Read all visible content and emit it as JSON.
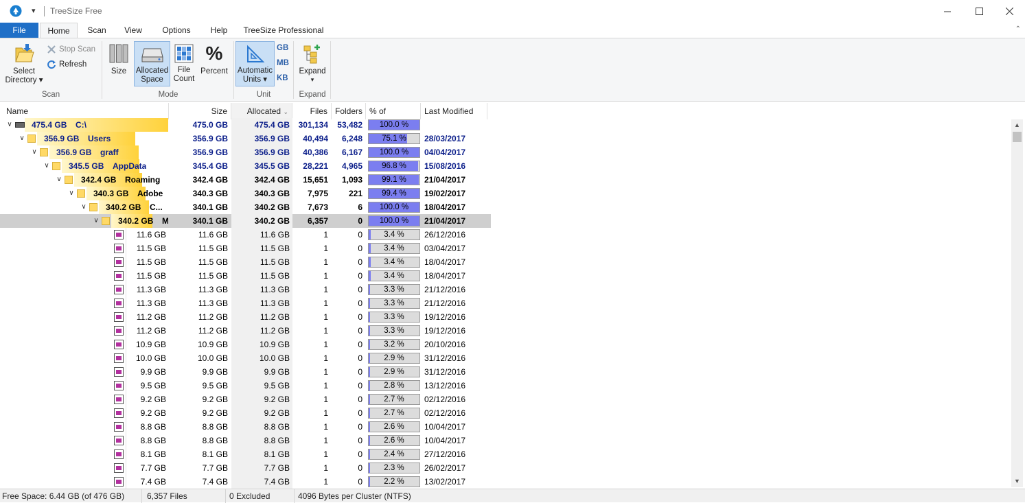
{
  "window": {
    "title": "TreeSize Free",
    "controls": [
      "minimize",
      "maximize",
      "close"
    ]
  },
  "tabs": [
    {
      "label": "File",
      "key": "file"
    },
    {
      "label": "Home",
      "key": "home",
      "active": true
    },
    {
      "label": "Scan",
      "key": "scan"
    },
    {
      "label": "View",
      "key": "view"
    },
    {
      "label": "Options",
      "key": "options"
    },
    {
      "label": "Help",
      "key": "help"
    },
    {
      "label": "TreeSize Professional",
      "key": "pro"
    }
  ],
  "ribbon": {
    "scan": {
      "select_directory": "Select\nDirectory",
      "stop_scan": "Stop Scan",
      "refresh": "Refresh",
      "group_label": "Scan"
    },
    "mode": {
      "size": "Size",
      "allocated_space": "Allocated\nSpace",
      "file_count": "File\nCount",
      "percent": "Percent",
      "percent_glyph": "%",
      "group_label": "Mode"
    },
    "unit": {
      "automatic_units": "Automatic\nUnits",
      "gb": "GB",
      "mb": "MB",
      "kb": "KB",
      "group_label": "Unit"
    },
    "expand": {
      "expand": "Expand",
      "group_label": "Expand"
    }
  },
  "columns": {
    "name": "Name",
    "size": "Size",
    "allocated": "Allocated",
    "files": "Files",
    "folders": "Folders",
    "percent": "% of Paren...",
    "modified": "Last Modified"
  },
  "tree_rows": [
    {
      "depth": 0,
      "kind": "drive",
      "name_size": "475.4 GB",
      "name": "C:\\",
      "size": "475.0 GB",
      "allocated": "475.4 GB",
      "files": "301,134",
      "folders": "53,482",
      "percent": 100.0,
      "percent_label": "100.0 %",
      "modified": "",
      "style": "blue",
      "barfrac": 1.0
    },
    {
      "depth": 1,
      "kind": "folder",
      "name_size": "356.9 GB",
      "name": "Users",
      "size": "356.9 GB",
      "allocated": "356.9 GB",
      "files": "40,494",
      "folders": "6,248",
      "percent": 75.1,
      "percent_label": "75.1 %",
      "modified": "28/03/2017",
      "style": "blue",
      "barfrac": 0.75
    },
    {
      "depth": 2,
      "kind": "folder",
      "name_size": "356.9 GB",
      "name": "graff",
      "size": "356.9 GB",
      "allocated": "356.9 GB",
      "files": "40,386",
      "folders": "6,167",
      "percent": 100.0,
      "percent_label": "100.0 %",
      "modified": "04/04/2017",
      "style": "blue",
      "barfrac": 0.75
    },
    {
      "depth": 3,
      "kind": "folder",
      "name_size": "345.5 GB",
      "name": "AppData",
      "size": "345.4 GB",
      "allocated": "345.5 GB",
      "files": "28,221",
      "folders": "4,965",
      "percent": 96.8,
      "percent_label": "96.8 %",
      "modified": "15/08/2016",
      "style": "blue",
      "barfrac": 0.73
    },
    {
      "depth": 4,
      "kind": "folder",
      "name_size": "342.4 GB",
      "name": "Roaming",
      "size": "342.4 GB",
      "allocated": "342.4 GB",
      "files": "15,651",
      "folders": "1,093",
      "percent": 99.1,
      "percent_label": "99.1 %",
      "modified": "21/04/2017",
      "style": "black",
      "barfrac": 0.72
    },
    {
      "depth": 5,
      "kind": "folder",
      "name_size": "340.3 GB",
      "name": "Adobe",
      "size": "340.3 GB",
      "allocated": "340.3 GB",
      "files": "7,975",
      "folders": "221",
      "percent": 99.4,
      "percent_label": "99.4 %",
      "modified": "19/02/2017",
      "style": "black",
      "barfrac": 0.72
    },
    {
      "depth": 6,
      "kind": "folder",
      "name_size": "340.2 GB",
      "name": "C...",
      "size": "340.1 GB",
      "allocated": "340.2 GB",
      "files": "7,673",
      "folders": "6",
      "percent": 100.0,
      "percent_label": "100.0 %",
      "modified": "18/04/2017",
      "style": "black",
      "barfrac": 0.72
    },
    {
      "depth": 7,
      "kind": "folder",
      "name_size": "340.2 GB",
      "name": "M...",
      "size": "340.1 GB",
      "allocated": "340.2 GB",
      "files": "6,357",
      "folders": "0",
      "percent": 100.0,
      "percent_label": "100.0 %",
      "modified": "21/04/2017",
      "style": "black",
      "barfrac": 0.72,
      "selected": true
    }
  ],
  "file_rows": [
    {
      "name_size": "11.6 GB",
      "size": "11.6 GB",
      "allocated": "11.6 GB",
      "files": "1",
      "folders": "0",
      "percent": 3.4,
      "percent_label": "3.4 %",
      "modified": "26/12/2016"
    },
    {
      "name_size": "11.5 GB",
      "size": "11.5 GB",
      "allocated": "11.5 GB",
      "files": "1",
      "folders": "0",
      "percent": 3.4,
      "percent_label": "3.4 %",
      "modified": "03/04/2017"
    },
    {
      "name_size": "11.5 GB",
      "size": "11.5 GB",
      "allocated": "11.5 GB",
      "files": "1",
      "folders": "0",
      "percent": 3.4,
      "percent_label": "3.4 %",
      "modified": "18/04/2017"
    },
    {
      "name_size": "11.5 GB",
      "size": "11.5 GB",
      "allocated": "11.5 GB",
      "files": "1",
      "folders": "0",
      "percent": 3.4,
      "percent_label": "3.4 %",
      "modified": "18/04/2017"
    },
    {
      "name_size": "11.3 GB",
      "size": "11.3 GB",
      "allocated": "11.3 GB",
      "files": "1",
      "folders": "0",
      "percent": 3.3,
      "percent_label": "3.3 %",
      "modified": "21/12/2016"
    },
    {
      "name_size": "11.3 GB",
      "size": "11.3 GB",
      "allocated": "11.3 GB",
      "files": "1",
      "folders": "0",
      "percent": 3.3,
      "percent_label": "3.3 %",
      "modified": "21/12/2016"
    },
    {
      "name_size": "11.2 GB",
      "size": "11.2 GB",
      "allocated": "11.2 GB",
      "files": "1",
      "folders": "0",
      "percent": 3.3,
      "percent_label": "3.3 %",
      "modified": "19/12/2016"
    },
    {
      "name_size": "11.2 GB",
      "size": "11.2 GB",
      "allocated": "11.2 GB",
      "files": "1",
      "folders": "0",
      "percent": 3.3,
      "percent_label": "3.3 %",
      "modified": "19/12/2016"
    },
    {
      "name_size": "10.9 GB",
      "size": "10.9 GB",
      "allocated": "10.9 GB",
      "files": "1",
      "folders": "0",
      "percent": 3.2,
      "percent_label": "3.2 %",
      "modified": "20/10/2016"
    },
    {
      "name_size": "10.0 GB",
      "size": "10.0 GB",
      "allocated": "10.0 GB",
      "files": "1",
      "folders": "0",
      "percent": 2.9,
      "percent_label": "2.9 %",
      "modified": "31/12/2016"
    },
    {
      "name_size": "9.9 GB",
      "size": "9.9 GB",
      "allocated": "9.9 GB",
      "files": "1",
      "folders": "0",
      "percent": 2.9,
      "percent_label": "2.9 %",
      "modified": "31/12/2016"
    },
    {
      "name_size": "9.5 GB",
      "size": "9.5 GB",
      "allocated": "9.5 GB",
      "files": "1",
      "folders": "0",
      "percent": 2.8,
      "percent_label": "2.8 %",
      "modified": "13/12/2016"
    },
    {
      "name_size": "9.2 GB",
      "size": "9.2 GB",
      "allocated": "9.2 GB",
      "files": "1",
      "folders": "0",
      "percent": 2.7,
      "percent_label": "2.7 %",
      "modified": "02/12/2016"
    },
    {
      "name_size": "9.2 GB",
      "size": "9.2 GB",
      "allocated": "9.2 GB",
      "files": "1",
      "folders": "0",
      "percent": 2.7,
      "percent_label": "2.7 %",
      "modified": "02/12/2016"
    },
    {
      "name_size": "8.8 GB",
      "size": "8.8 GB",
      "allocated": "8.8 GB",
      "files": "1",
      "folders": "0",
      "percent": 2.6,
      "percent_label": "2.6 %",
      "modified": "10/04/2017"
    },
    {
      "name_size": "8.8 GB",
      "size": "8.8 GB",
      "allocated": "8.8 GB",
      "files": "1",
      "folders": "0",
      "percent": 2.6,
      "percent_label": "2.6 %",
      "modified": "10/04/2017"
    },
    {
      "name_size": "8.1 GB",
      "size": "8.1 GB",
      "allocated": "8.1 GB",
      "files": "1",
      "folders": "0",
      "percent": 2.4,
      "percent_label": "2.4 %",
      "modified": "27/12/2016"
    },
    {
      "name_size": "7.7 GB",
      "size": "7.7 GB",
      "allocated": "7.7 GB",
      "files": "1",
      "folders": "0",
      "percent": 2.3,
      "percent_label": "2.3 %",
      "modified": "26/02/2017"
    },
    {
      "name_size": "7.4 GB",
      "size": "7.4 GB",
      "allocated": "7.4 GB",
      "files": "1",
      "folders": "0",
      "percent": 2.2,
      "percent_label": "2.2 %",
      "modified": "13/02/2017"
    }
  ],
  "status": {
    "free_space": "Free Space: 6.44 GB  (of 476 GB)",
    "files": "6,357  Files",
    "excluded": "0 Excluded",
    "cluster": "4096  Bytes per Cluster (NTFS)"
  },
  "colors": {
    "accent": "#1f6fc7",
    "bar_fill": "#7b7ef0",
    "folder_bar": "#ffd23b",
    "blue_text": "#0b1e8a",
    "file_icon": "#b2309e"
  }
}
